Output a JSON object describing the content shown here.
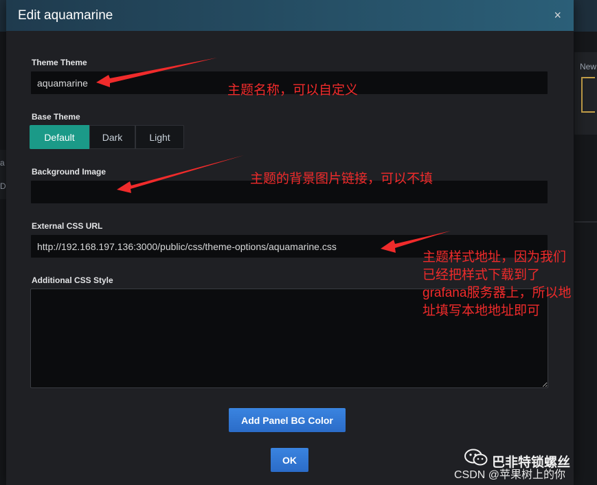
{
  "modal": {
    "title": "Edit aquamarine",
    "close_label": "×"
  },
  "fields": {
    "theme_name": {
      "label": "Theme Theme",
      "value": "aquamarine"
    },
    "base_theme": {
      "label": "Base Theme",
      "options": [
        "Default",
        "Dark",
        "Light"
      ],
      "selected": "Default"
    },
    "background_image": {
      "label": "Background Image",
      "value": ""
    },
    "external_css": {
      "label": "External CSS URL",
      "value": "http://192.168.197.136:3000/public/css/theme-options/aquamarine.css"
    },
    "additional_css": {
      "label": "Additional CSS Style",
      "value": ""
    }
  },
  "buttons": {
    "add_panel_bg": "Add Panel BG Color",
    "ok": "OK"
  },
  "annotations": {
    "theme_name": "主题名称，可以自定义",
    "background": "主题的背景图片链接，可以不填",
    "css_line1": "主题样式地址，因为我们",
    "css_line2": "已经把样式下载到了",
    "css_line3": "grafana服务器上，所以地",
    "css_line4": "址填写本地地址即可"
  },
  "background_app": {
    "right_text": "New",
    "left_text1": "a",
    "left_text2": "D"
  },
  "watermark": {
    "account": "巴非特锁螺丝",
    "csdn": "CSDN @苹果树上的你"
  },
  "colors": {
    "accent_green": "#1b9a88",
    "primary_blue": "#3274d9",
    "annotation_red": "#f02b2b"
  }
}
